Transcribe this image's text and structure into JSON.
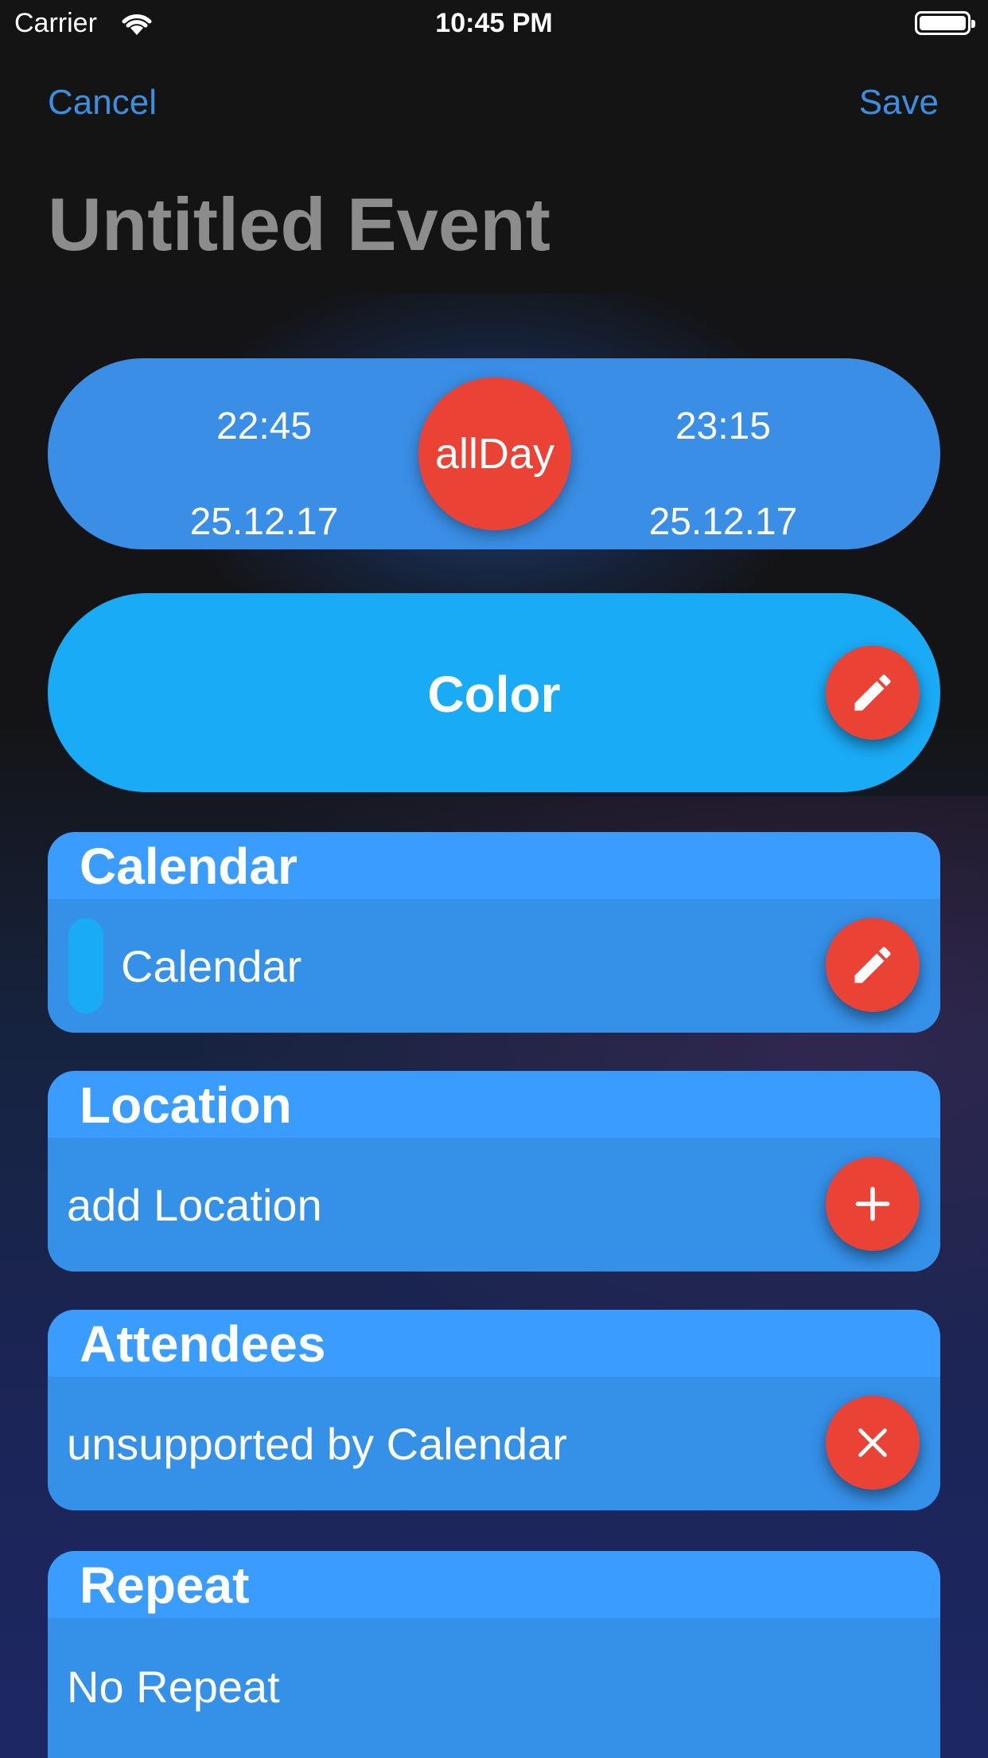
{
  "status_bar": {
    "carrier": "Carrier",
    "time": "10:45 PM"
  },
  "nav": {
    "cancel_label": "Cancel",
    "save_label": "Save"
  },
  "event": {
    "title": "Untitled Event"
  },
  "time_range": {
    "start_time": "22:45",
    "start_date": "25.12.17",
    "end_time": "23:15",
    "end_date": "25.12.17",
    "all_day_label": "allDay"
  },
  "color_section": {
    "label": "Color"
  },
  "calendar_section": {
    "header": "Calendar",
    "value": "Calendar"
  },
  "location_section": {
    "header": "Location",
    "value": "add Location"
  },
  "attendees_section": {
    "header": "Attendees",
    "value": "unsupported by Calendar"
  },
  "repeat_section": {
    "header": "Repeat",
    "value": "No Repeat"
  },
  "colors": {
    "accent_blue": "#3a8ee6",
    "color_pill": "#1aabf6",
    "card_blue": "#3a9cff",
    "action_red": "#ea4335",
    "nav_link": "#3c8fe0"
  },
  "icons": {
    "wifi": "wifi-icon",
    "battery": "battery-icon",
    "edit": "pencil-icon",
    "add": "plus-icon",
    "remove": "close-icon"
  }
}
